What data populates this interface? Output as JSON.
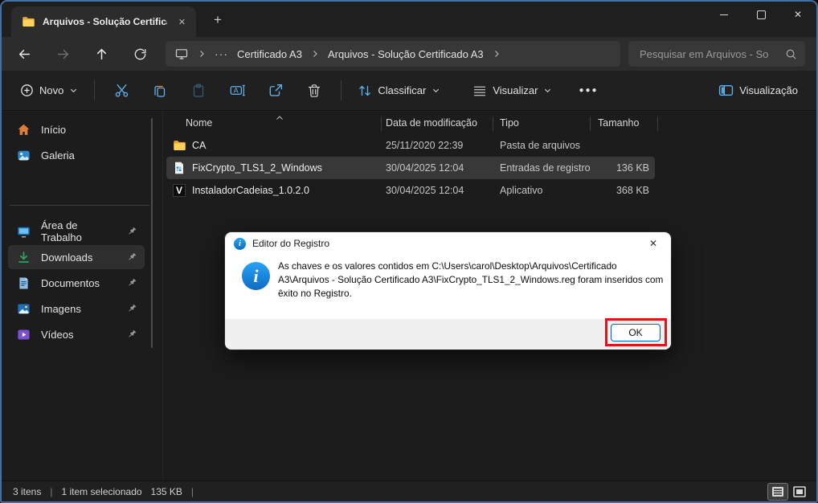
{
  "titlebar": {
    "tab_title": "Arquivos - Solução Certificado"
  },
  "glyphs": {
    "close": "✕",
    "plus": "+",
    "more": "●●●",
    "ellipsis": "···",
    "divider": "|",
    "info": "i"
  },
  "address_bar": {
    "breadcrumb": {
      "segment1": "Certificado A3",
      "segment2": "Arquivos - Solução Certificado A3"
    },
    "search_placeholder": "Pesquisar em Arquivos - So"
  },
  "toolbar": {
    "new_label": "Novo",
    "sort_label": "Classificar",
    "view_label": "Visualizar",
    "preview_label": "Visualização"
  },
  "sidebar": {
    "items": [
      {
        "label": "Início",
        "pinned": false,
        "selected": false
      },
      {
        "label": "Galeria",
        "pinned": false,
        "selected": false
      },
      {
        "label": "Área de Trabalho",
        "pinned": true,
        "selected": false
      },
      {
        "label": "Downloads",
        "pinned": true,
        "selected": true
      },
      {
        "label": "Documentos",
        "pinned": true,
        "selected": false
      },
      {
        "label": "Imagens",
        "pinned": true,
        "selected": false
      },
      {
        "label": "Vídeos",
        "pinned": true,
        "selected": false
      }
    ]
  },
  "file_list": {
    "columns": {
      "name": "Nome",
      "modified": "Data de modificação",
      "type": "Tipo",
      "size": "Tamanho"
    },
    "app_icon_letter": "V",
    "rows": [
      {
        "name": "CA",
        "modified": "25/11/2020 22:39",
        "type": "Pasta de arquivos",
        "size": "",
        "selected": false
      },
      {
        "name": "FixCrypto_TLS1_2_Windows",
        "modified": "30/04/2025 12:04",
        "type": "Entradas de registro",
        "size": "136 KB",
        "selected": true
      },
      {
        "name": "InstaladorCadeias_1.0.2.0",
        "modified": "30/04/2025 12:04",
        "type": "Aplicativo",
        "size": "368 KB",
        "selected": false
      }
    ]
  },
  "dialog": {
    "title": "Editor do Registro",
    "message": "As chaves e os valores contidos em C:\\Users\\carol\\Desktop\\Arquivos\\Certificado A3\\Arquivos - Solução Certificado A3\\FixCrypto_TLS1_2_Windows.reg foram inseridos com êxito no Registro.",
    "ok_label": "OK"
  },
  "status_bar": {
    "count": "3 itens",
    "selected": "1 item selecionado",
    "selected_size": "135 KB"
  },
  "colors": {
    "accent_blue": "#5db2ef",
    "info_blue": "#0f7ad4",
    "ok_focus_border": "#0067c0",
    "highlight_red": "#e01515",
    "window_edge_blue": "#44719f",
    "downloads_green": "#27a463",
    "folder_yellow": "#ffd159",
    "videos_purple": "#7a4fd0"
  }
}
